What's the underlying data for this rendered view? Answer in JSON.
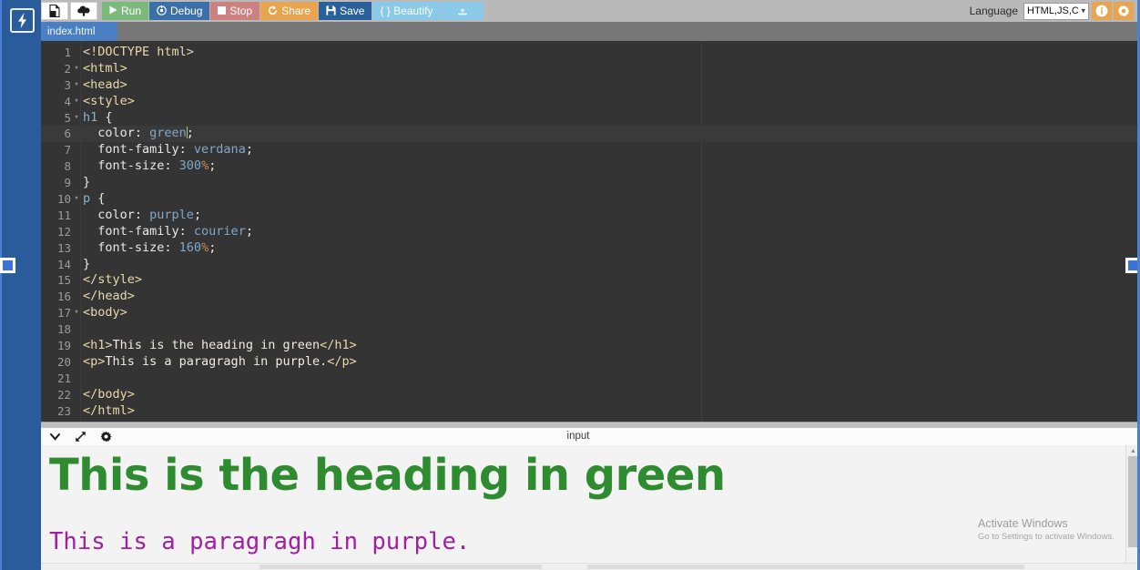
{
  "app": {
    "logo_icon": "lightning-bolt-icon"
  },
  "toolbar": {
    "new_file_icon": "file-page-icon",
    "upload_icon": "upload-cloud-icon",
    "run_label": "Run",
    "run_icon": "play-triangle-icon",
    "run_color": "#7cb97c",
    "debug_label": "Debug",
    "debug_icon": "debug-target-icon",
    "debug_color": "#3a6fa8",
    "stop_label": "Stop",
    "stop_icon": "stop-square-icon",
    "stop_color": "#cd8080",
    "share_label": "Share",
    "share_icon": "share-refresh-icon",
    "share_color": "#e9a44f",
    "save_label": "Save",
    "save_icon": "floppy-disk-icon",
    "save_color": "#2a6099",
    "beautify_label": "{ } Beautify",
    "beautify_color": "#8ac9e8",
    "download_icon": "download-icon",
    "download_color": "#8ac9e8",
    "language_label": "Language",
    "language_value": "HTML,JS,C",
    "language_caret": "chevron-down-icon",
    "info_icon": "info-circle-icon",
    "settings_icon": "gear-icon",
    "accent_orange": "#e9a44f"
  },
  "tabs": [
    {
      "label": "index.html",
      "active": true
    }
  ],
  "editor": {
    "active_line": 6,
    "lines": [
      {
        "n": 1,
        "fold": "",
        "tokens": [
          {
            "t": "tag",
            "v": "<!DOCTYPE html>"
          }
        ]
      },
      {
        "n": 2,
        "fold": "▾",
        "tokens": [
          {
            "t": "tag",
            "v": "<html>"
          }
        ]
      },
      {
        "n": 3,
        "fold": "▾",
        "tokens": [
          {
            "t": "tag",
            "v": "<head>"
          }
        ]
      },
      {
        "n": 4,
        "fold": "▾",
        "tokens": [
          {
            "t": "tag",
            "v": "<style>"
          }
        ]
      },
      {
        "n": 5,
        "fold": "▾",
        "tokens": [
          {
            "t": "sel",
            "v": "h1"
          },
          {
            "t": "punct",
            "v": " {"
          }
        ]
      },
      {
        "n": 6,
        "fold": "",
        "tokens": [
          {
            "t": "prop",
            "v": "  color: "
          },
          {
            "t": "val",
            "v": "green"
          },
          {
            "t": "caret",
            "v": ""
          },
          {
            "t": "punct",
            "v": ";"
          }
        ]
      },
      {
        "n": 7,
        "fold": "",
        "tokens": [
          {
            "t": "prop",
            "v": "  font-family: "
          },
          {
            "t": "val",
            "v": "verdana"
          },
          {
            "t": "punct",
            "v": ";"
          }
        ]
      },
      {
        "n": 8,
        "fold": "",
        "tokens": [
          {
            "t": "prop",
            "v": "  font-size: "
          },
          {
            "t": "num",
            "v": "300"
          },
          {
            "t": "unit",
            "v": "%"
          },
          {
            "t": "punct",
            "v": ";"
          }
        ]
      },
      {
        "n": 9,
        "fold": "",
        "tokens": [
          {
            "t": "punct",
            "v": "}"
          }
        ]
      },
      {
        "n": 10,
        "fold": "▾",
        "tokens": [
          {
            "t": "sel",
            "v": "p"
          },
          {
            "t": "punct",
            "v": " {"
          }
        ]
      },
      {
        "n": 11,
        "fold": "",
        "tokens": [
          {
            "t": "prop",
            "v": "  color: "
          },
          {
            "t": "val",
            "v": "purple"
          },
          {
            "t": "punct",
            "v": ";"
          }
        ]
      },
      {
        "n": 12,
        "fold": "",
        "tokens": [
          {
            "t": "prop",
            "v": "  font-family: "
          },
          {
            "t": "val",
            "v": "courier"
          },
          {
            "t": "punct",
            "v": ";"
          }
        ]
      },
      {
        "n": 13,
        "fold": "",
        "tokens": [
          {
            "t": "prop",
            "v": "  font-size: "
          },
          {
            "t": "num",
            "v": "160"
          },
          {
            "t": "unit",
            "v": "%"
          },
          {
            "t": "punct",
            "v": ";"
          }
        ]
      },
      {
        "n": 14,
        "fold": "",
        "tokens": [
          {
            "t": "punct",
            "v": "}"
          }
        ]
      },
      {
        "n": 15,
        "fold": "",
        "tokens": [
          {
            "t": "tag",
            "v": "</style>"
          }
        ]
      },
      {
        "n": 16,
        "fold": "",
        "tokens": [
          {
            "t": "tag",
            "v": "</head>"
          }
        ]
      },
      {
        "n": 17,
        "fold": "▾",
        "tokens": [
          {
            "t": "tag",
            "v": "<body>"
          }
        ]
      },
      {
        "n": 18,
        "fold": "",
        "tokens": []
      },
      {
        "n": 19,
        "fold": "",
        "tokens": [
          {
            "t": "tag",
            "v": "<h1>"
          },
          {
            "t": "text",
            "v": "This is the heading in green"
          },
          {
            "t": "tag",
            "v": "</h1>"
          }
        ]
      },
      {
        "n": 20,
        "fold": "",
        "tokens": [
          {
            "t": "tag",
            "v": "<p>"
          },
          {
            "t": "text",
            "v": "This is a paragragh in purple."
          },
          {
            "t": "tag",
            "v": "</p>"
          }
        ]
      },
      {
        "n": 21,
        "fold": "",
        "tokens": []
      },
      {
        "n": 22,
        "fold": "",
        "tokens": [
          {
            "t": "tag",
            "v": "</body>"
          }
        ]
      },
      {
        "n": 23,
        "fold": "",
        "tokens": [
          {
            "t": "tag",
            "v": "</html>"
          }
        ]
      }
    ]
  },
  "output_panel": {
    "title": "input",
    "collapse_icon": "chevron-down-icon",
    "expand_icon": "expand-diagonal-icon",
    "settings_icon": "gear-icon",
    "preview": {
      "heading": "This is the heading in green",
      "heading_color": "#2f8b2f",
      "paragraph": "This is a paragragh in purple.",
      "paragraph_color": "#a020a0"
    }
  },
  "watermark": {
    "line1": "Activate Windows",
    "line2": "Go to Settings to activate Windows."
  }
}
